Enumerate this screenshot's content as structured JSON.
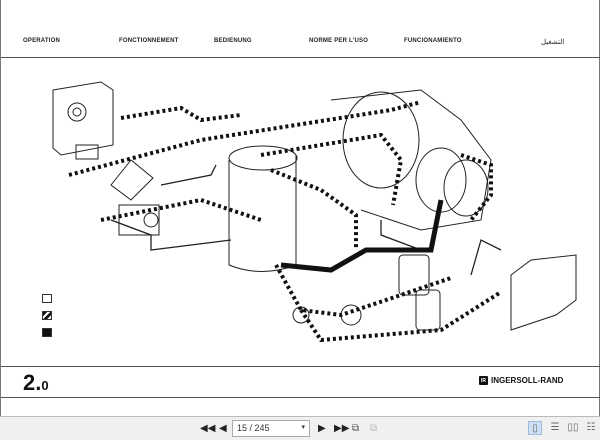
{
  "header": {
    "columns": [
      "OPERATION",
      "FONCTIONNEMENT",
      "BEDIENUNG",
      "NORME PER L'USO",
      "FUNCIONAMIENTO",
      "التشغيل"
    ]
  },
  "footer": {
    "section_major": "2.",
    "section_minor": "0",
    "brand": "INGERSOLL-RAND",
    "brand_mark": "IR"
  },
  "legend": [
    {
      "fill": "none"
    },
    {
      "fill": "hatched"
    },
    {
      "fill": "solid"
    }
  ],
  "toolbar": {
    "page_value": "15 / 245",
    "current_page": 15,
    "total_pages": 245,
    "dropdown_icon": "▾"
  },
  "colors": {
    "toolbar_bg": "#f0f0f0",
    "ink": "#111111"
  }
}
